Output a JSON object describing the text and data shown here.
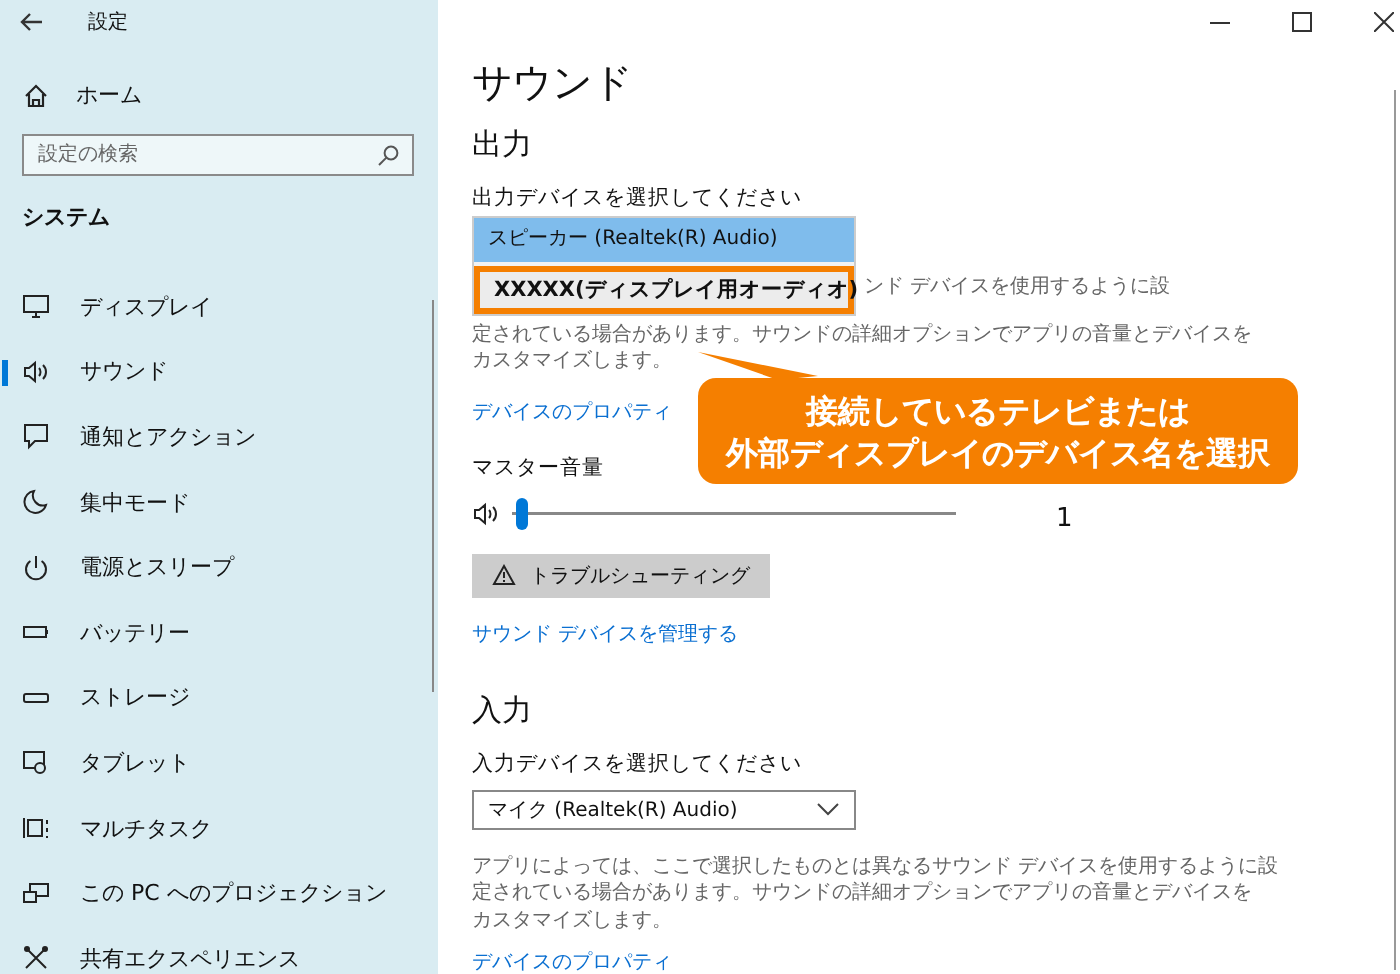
{
  "window": {
    "title": "設定"
  },
  "sidebar": {
    "home": "ホーム",
    "search": {
      "placeholder": "設定の検索"
    },
    "section": "システム",
    "items": [
      {
        "label": "ディスプレイ",
        "selected": false
      },
      {
        "label": "サウンド",
        "selected": true
      },
      {
        "label": "通知とアクション",
        "selected": false
      },
      {
        "label": "集中モード",
        "selected": false
      },
      {
        "label": "電源とスリープ",
        "selected": false
      },
      {
        "label": "バッテリー",
        "selected": false
      },
      {
        "label": "ストレージ",
        "selected": false
      },
      {
        "label": "タブレット",
        "selected": false
      },
      {
        "label": "マルチタスク",
        "selected": false
      },
      {
        "label": "この PC へのプロジェクション",
        "selected": false
      },
      {
        "label": "共有エクスペリエンス",
        "selected": false
      }
    ]
  },
  "page_title": "サウンド",
  "output": {
    "heading": "出力",
    "label": "出力デバイスを選択してください",
    "options": [
      {
        "label": "スピーカー (Realtek(R) Audio)",
        "selected": true,
        "highlighted": false
      },
      {
        "label": "XXXXX(ディスプレイ用オーディオ)",
        "selected": false,
        "highlighted": true
      }
    ],
    "description": [
      "ンド デバイスを使用するように設",
      "定されている場合があります。サウンドの詳細オプションでアプリの音量とデバイスを",
      "カスタマイズします。"
    ],
    "properties_link": "デバイスのプロパティ",
    "volume_label": "マスター音量",
    "volume": {
      "level": 0.01,
      "reading": "1"
    },
    "troubleshoot": "トラブルシューティング",
    "manage_link": "サウンド デバイスを管理する"
  },
  "input": {
    "heading": "入力",
    "label": "入力デバイスを選択してください",
    "device": "マイク (Realtek(R) Audio)",
    "description": [
      "アプリによっては、ここで選択したものとは異なるサウンド デバイスを使用するように設",
      "定されている場合があります。サウンドの詳細オプションでアプリの音量とデバイスを",
      "カスタマイズします。"
    ],
    "properties_link": "デバイスのプロパティ"
  },
  "callout": [
    "接続しているテレビまたは",
    "外部ディスプレイのデバイス名を選択"
  ]
}
